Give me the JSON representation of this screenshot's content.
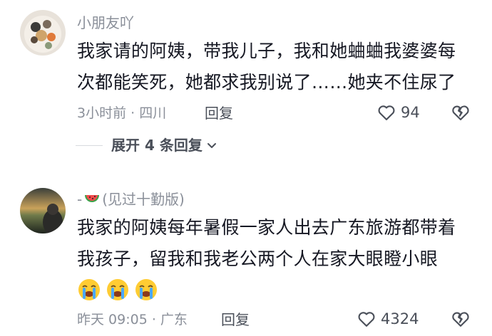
{
  "comments": [
    {
      "username": "小朋友吖",
      "text_lines": [
        "我家请的阿姨，带我儿子，我和她蛐蛐我婆婆每",
        "次都能笑死，她都求我别说了……她夹不住尿了"
      ],
      "meta": "3小时前 · 四川",
      "reply_label": "回复",
      "like_count": "94",
      "expand_label": "展开 4 条回复"
    },
    {
      "username_prefix": "-",
      "username_suffix": "(见过十勤版)",
      "text_lines": [
        "我家的阿姨每年暑假一家人出去广东旅游都带着",
        "我孩子，留我和我老公两个人在家大眼瞪小眼"
      ],
      "meta": "昨天 09:05 · 广东",
      "reply_label": "回复",
      "like_count": "4324"
    }
  ],
  "icons": {
    "like": "heart-outline-icon",
    "dislike": "broken-heart-icon",
    "expand_chevron": "chevron-down-icon",
    "username_emoji": "watermelon-icon",
    "reaction_emoji": "loudly-crying-face-icon"
  },
  "colors": {
    "text_primary": "#161823",
    "text_secondary": "#8a8f99",
    "action_text": "#4a4f59"
  }
}
